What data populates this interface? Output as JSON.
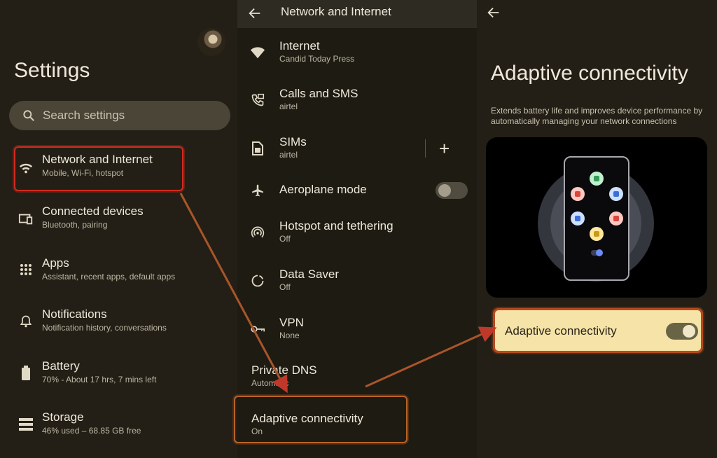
{
  "settings": {
    "title": "Settings",
    "search_placeholder": "Search settings",
    "items": [
      {
        "title": "Network and Internet",
        "subtitle": "Mobile, Wi-Fi, hotspot",
        "icon": "wifi-icon"
      },
      {
        "title": "Connected devices",
        "subtitle": "Bluetooth, pairing",
        "icon": "devices-icon"
      },
      {
        "title": "Apps",
        "subtitle": "Assistant, recent apps, default apps",
        "icon": "apps-grid-icon"
      },
      {
        "title": "Notifications",
        "subtitle": "Notification history, conversations",
        "icon": "bell-icon"
      },
      {
        "title": "Battery",
        "subtitle": "70% - About 17 hrs, 7 mins left",
        "icon": "battery-icon"
      },
      {
        "title": "Storage",
        "subtitle": "46% used – 68.85 GB free",
        "icon": "storage-icon"
      }
    ]
  },
  "network": {
    "title": "Network and Internet",
    "items": [
      {
        "title": "Internet",
        "subtitle": "Candid Today Press",
        "icon": "wifi-icon"
      },
      {
        "title": "Calls and SMS",
        "subtitle": "airtel",
        "icon": "phone-message-icon"
      },
      {
        "title": "SIMs",
        "subtitle": "airtel",
        "icon": "sim-icon"
      },
      {
        "title": "Aeroplane mode",
        "subtitle": "",
        "icon": "airplane-icon",
        "toggle": "off"
      },
      {
        "title": "Hotspot and tethering",
        "subtitle": "Off",
        "icon": "hotspot-icon"
      },
      {
        "title": "Data Saver",
        "subtitle": "Off",
        "icon": "data-saver-icon"
      },
      {
        "title": "VPN",
        "subtitle": "None",
        "icon": "vpn-key-icon"
      },
      {
        "title": "Private DNS",
        "subtitle": "Automatic"
      },
      {
        "title": "Adaptive connectivity",
        "subtitle": "On"
      }
    ],
    "sims_add": "+"
  },
  "adaptive": {
    "title": "Adaptive connectivity",
    "description": "Extends battery life and improves device performance by automatically managing your network connections",
    "toggle_label": "Adaptive connectivity",
    "toggle_state": "on"
  },
  "colors": {
    "highlight_red": "#d22a1f",
    "highlight_orange": "#b7642a",
    "card_yellow": "#f6e3a8"
  }
}
